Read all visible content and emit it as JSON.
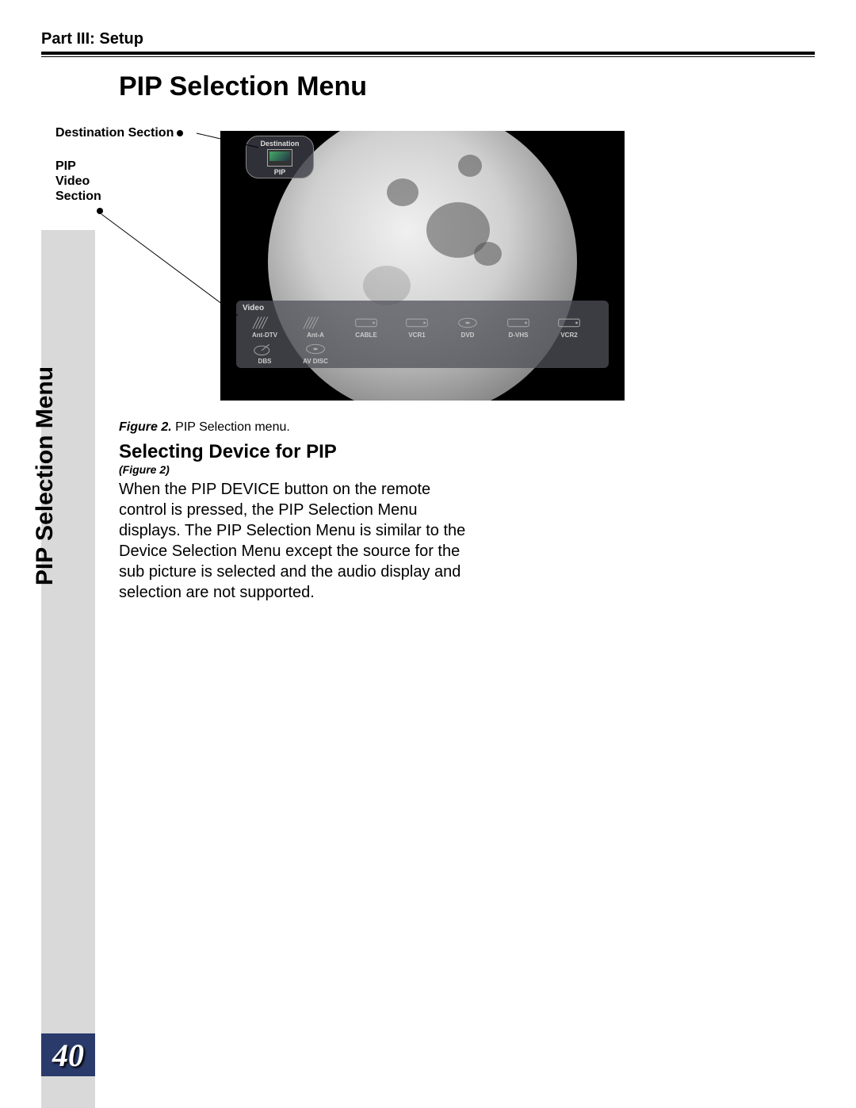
{
  "header": {
    "part": "Part III: Setup"
  },
  "page": {
    "title": "PIP Selection Menu",
    "sidetab": "PIP Selection Menu",
    "number": "40"
  },
  "annotations": {
    "destination": "Destination Section",
    "pip_video": "PIP\nVideo\nSection"
  },
  "figure": {
    "destination_label": "Destination",
    "pip_label": "PIP",
    "video_label": "Video",
    "caption_label": "Figure 2.",
    "caption_text": "PIP Selection menu.",
    "video_items_row1": [
      {
        "name": "Ant-DTV"
      },
      {
        "name": "Ant-A"
      },
      {
        "name": "CABLE"
      },
      {
        "name": "VCR1"
      },
      {
        "name": "DVD"
      },
      {
        "name": "D-VHS"
      },
      {
        "name": "VCR2"
      }
    ],
    "video_items_row2": [
      {
        "name": "DBS"
      },
      {
        "name": "AV DISC"
      }
    ]
  },
  "section": {
    "heading": "Selecting Device for PIP",
    "ref": "(Figure 2)",
    "body": "When the PIP DEVICE button on the remote control is pressed, the PIP Selection Menu displays.  The PIP Selection Menu is similar to the Device Selection Menu except the source for the sub picture is selected and the audio display and selection are not supported."
  }
}
